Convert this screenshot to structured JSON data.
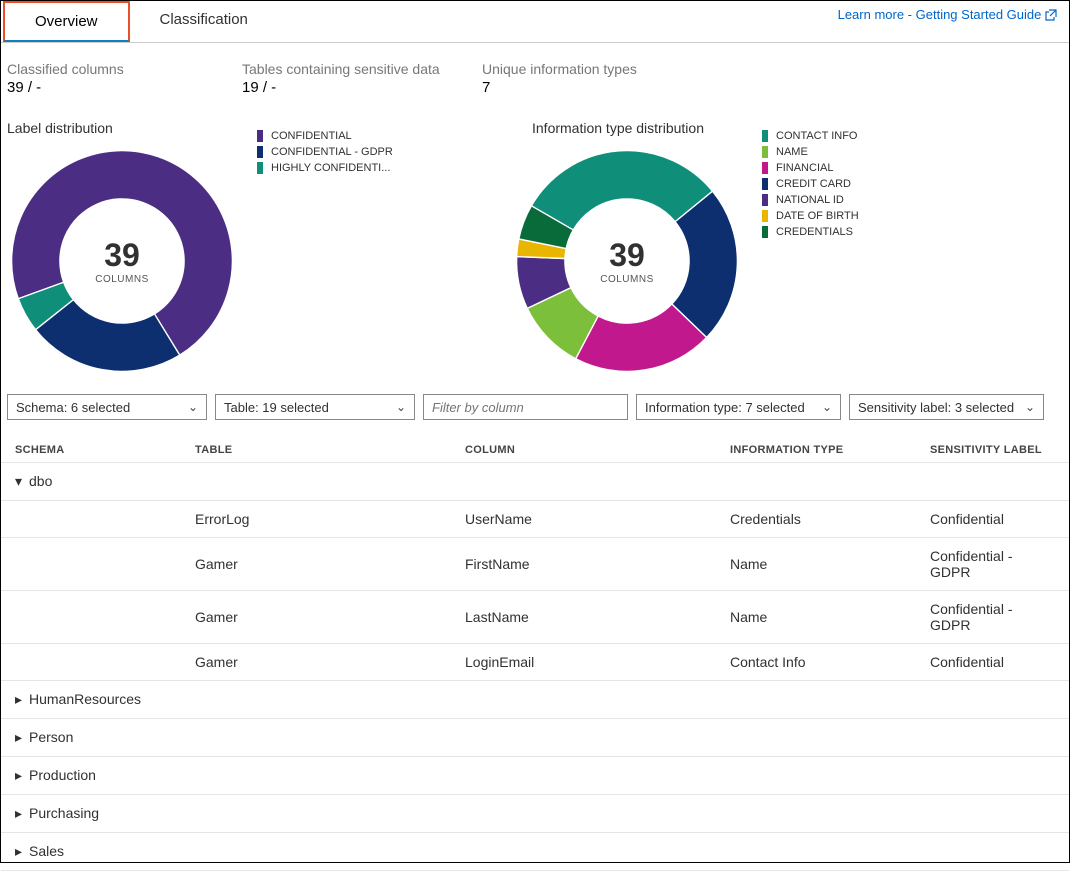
{
  "link": {
    "label": "Learn more - Getting Started Guide"
  },
  "tabs": {
    "overview": "Overview",
    "classification": "Classification"
  },
  "stats": {
    "classifiedColumns": {
      "label": "Classified columns",
      "value": "39 / -"
    },
    "tablesSensitive": {
      "label": "Tables containing sensitive data",
      "value": "19 / -"
    },
    "uniqueTypes": {
      "label": "Unique information types",
      "value": "7"
    }
  },
  "labelChart": {
    "title": "Label distribution",
    "centerNum": "39",
    "centerLbl": "COLUMNS",
    "legend": [
      {
        "name": "CONFIDENTIAL",
        "color": "#4b2e83"
      },
      {
        "name": "CONFIDENTIAL - GDPR",
        "color": "#0d2f6f"
      },
      {
        "name": "HIGHLY CONFIDENTI...",
        "color": "#0f8f7a"
      }
    ]
  },
  "infoChart": {
    "title": "Information type distribution",
    "centerNum": "39",
    "centerLbl": "COLUMNS",
    "legend": [
      {
        "name": "CONTACT INFO",
        "color": "#0f8f7a"
      },
      {
        "name": "NAME",
        "color": "#7bbf3a"
      },
      {
        "name": "FINANCIAL",
        "color": "#c2188e"
      },
      {
        "name": "CREDIT CARD",
        "color": "#0d2f6f"
      },
      {
        "name": "NATIONAL ID",
        "color": "#4b2e83"
      },
      {
        "name": "DATE OF BIRTH",
        "color": "#e8b500"
      },
      {
        "name": "CREDENTIALS",
        "color": "#0a6b3a"
      }
    ]
  },
  "filters": {
    "schema": "Schema: 6 selected",
    "table": "Table: 19 selected",
    "columnPlaceholder": "Filter by column",
    "infoType": "Information type: 7 selected",
    "sensLabel": "Sensitivity label: 3 selected"
  },
  "columns": {
    "schema": "SCHEMA",
    "table": "TABLE",
    "column": "COLUMN",
    "infoType": "INFORMATION TYPE",
    "sensLabel": "SENSITIVITY LABEL"
  },
  "groups": {
    "dbo": "dbo",
    "hr": "HumanResources",
    "person": "Person",
    "production": "Production",
    "purchasing": "Purchasing",
    "sales": "Sales"
  },
  "rows": [
    {
      "table": "ErrorLog",
      "column": "UserName",
      "infoType": "Credentials",
      "label": "Confidential"
    },
    {
      "table": "Gamer",
      "column": "FirstName",
      "infoType": "Name",
      "label": "Confidential - GDPR"
    },
    {
      "table": "Gamer",
      "column": "LastName",
      "infoType": "Name",
      "label": "Confidential - GDPR"
    },
    {
      "table": "Gamer",
      "column": "LoginEmail",
      "infoType": "Contact Info",
      "label": "Confidential"
    }
  ],
  "chart_data": [
    {
      "type": "pie",
      "title": "Label distribution",
      "series": [
        {
          "name": "CONFIDENTIAL",
          "value": 28,
          "color": "#4b2e83"
        },
        {
          "name": "CONFIDENTIAL - GDPR",
          "value": 9,
          "color": "#0d2f6f"
        },
        {
          "name": "HIGHLY CONFIDENTIAL",
          "value": 2,
          "color": "#0f8f7a"
        }
      ],
      "total": 39,
      "total_label": "COLUMNS",
      "donut": true
    },
    {
      "type": "pie",
      "title": "Information type distribution",
      "series": [
        {
          "name": "CONTACT INFO",
          "value": 12,
          "color": "#0f8f7a"
        },
        {
          "name": "CREDIT CARD",
          "value": 9,
          "color": "#0d2f6f"
        },
        {
          "name": "FINANCIAL",
          "value": 8,
          "color": "#c2188e"
        },
        {
          "name": "NAME",
          "value": 4,
          "color": "#7bbf3a"
        },
        {
          "name": "NATIONAL ID",
          "value": 3,
          "color": "#4b2e83"
        },
        {
          "name": "DATE OF BIRTH",
          "value": 1,
          "color": "#e8b500"
        },
        {
          "name": "CREDENTIALS",
          "value": 2,
          "color": "#0a6b3a"
        }
      ],
      "total": 39,
      "total_label": "COLUMNS",
      "donut": true
    }
  ]
}
